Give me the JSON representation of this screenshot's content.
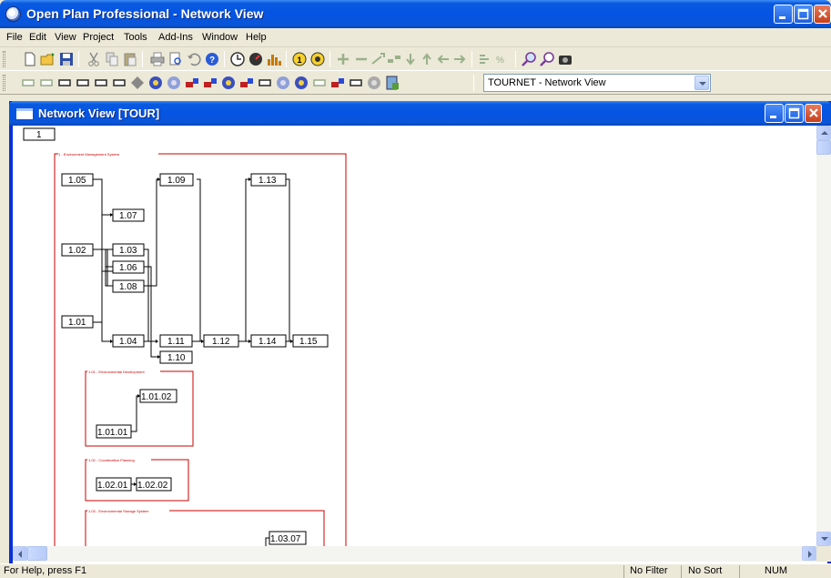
{
  "window": {
    "title": "Open Plan Professional - Network View"
  },
  "menu": [
    "File",
    "Edit",
    "View",
    "Project",
    "Tools",
    "Add-Ins",
    "Window",
    "Help"
  ],
  "view_selector": {
    "value": "TOURNET - Network View"
  },
  "child_window": {
    "title": "Network View [TOUR]"
  },
  "network": {
    "root_label": "1",
    "groups": [
      {
        "label": "1 - Environment Management System"
      },
      {
        "label": "1.01 - Environmental Development"
      },
      {
        "label": "1.02 - Coordination Planning"
      },
      {
        "label": "1.03 - Environmental Storage System"
      }
    ],
    "activities": [
      "1.05",
      "1.07",
      "1.02",
      "1.03",
      "1.06",
      "1.08",
      "1.01",
      "1.04",
      "1.09",
      "1.11",
      "1.10",
      "1.12",
      "1.13",
      "1.14",
      "1.15",
      "1.01.02",
      "1.01.01",
      "1.02.01",
      "1.02.02",
      "1.03.07"
    ]
  },
  "statusbar": {
    "help": "For Help, press F1",
    "filter": "No Filter",
    "sort": "No Sort",
    "num": "NUM"
  },
  "colors": {
    "titlebar": "#0554e3",
    "group_outline": "#cc0000"
  }
}
